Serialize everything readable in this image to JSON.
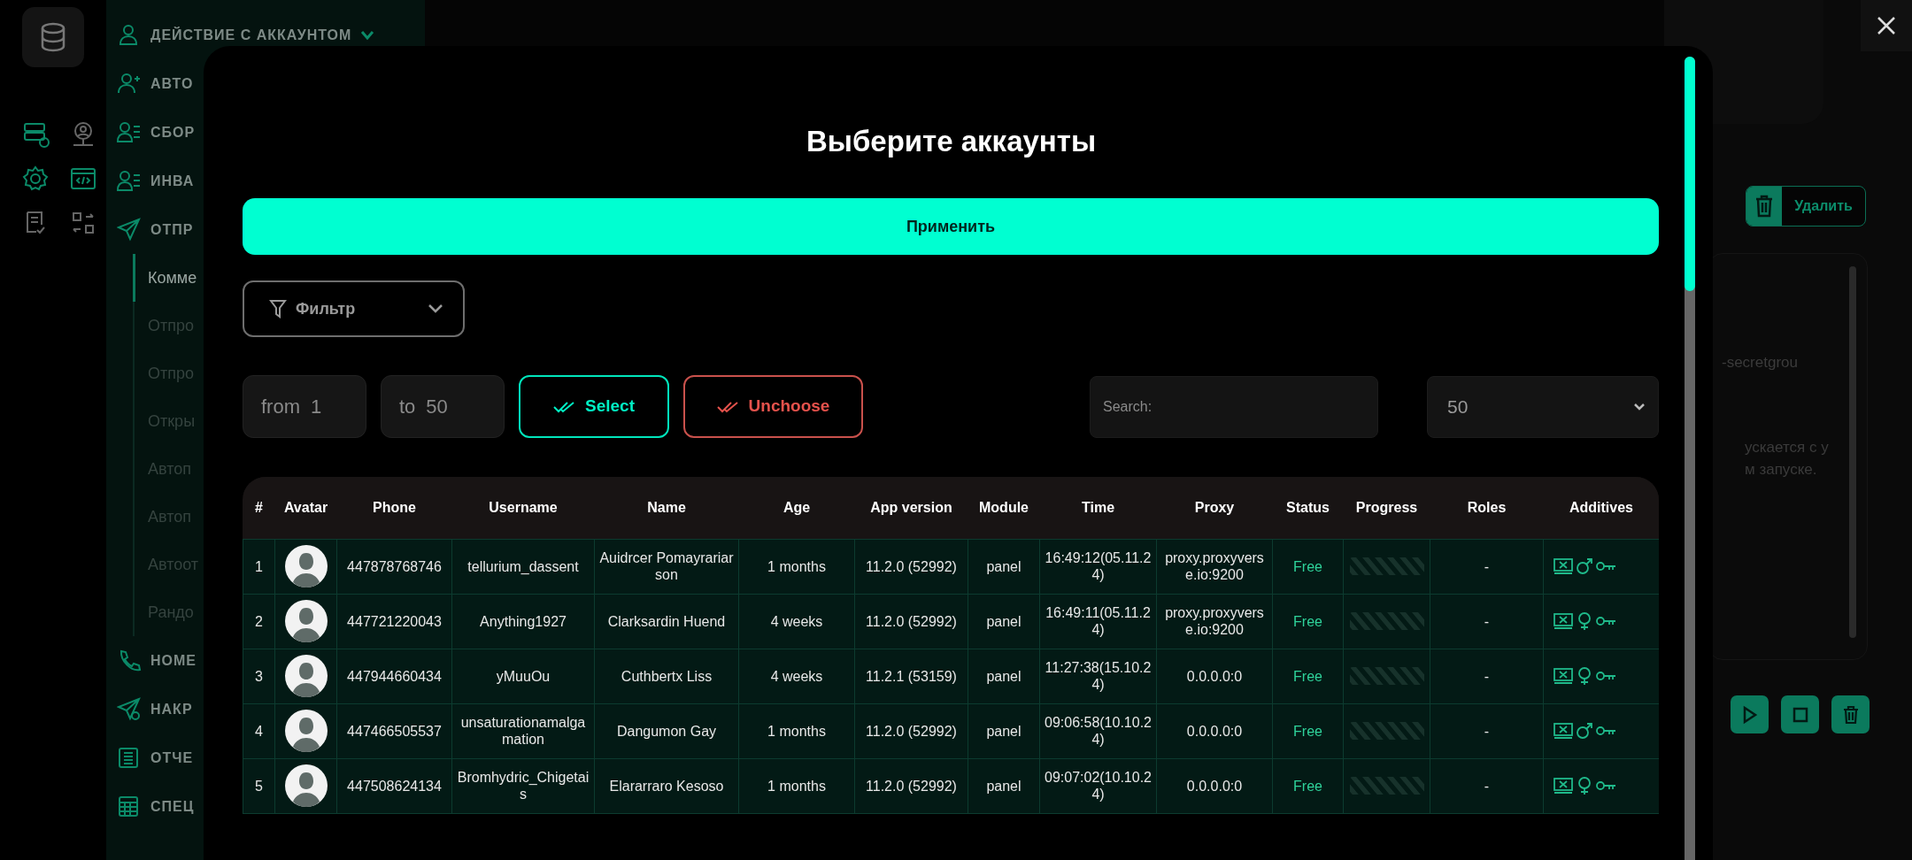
{
  "sidebar": {
    "items": [
      {
        "label": "ДЕЙСТВИЕ С АККАУНТОМ",
        "kind": "section",
        "expanded": true
      },
      {
        "label": "АВТО",
        "kind": "section",
        "expanded": false
      },
      {
        "label": "СБОР",
        "kind": "section",
        "expanded": false
      },
      {
        "label": "ИНВА",
        "kind": "section",
        "expanded": false
      },
      {
        "label": "ОТПР",
        "kind": "section",
        "expanded": false
      },
      {
        "label": "Комме",
        "kind": "sub",
        "selected": true
      },
      {
        "label": "Отпро",
        "kind": "sub",
        "selected": false
      },
      {
        "label": "Отпро",
        "kind": "sub",
        "selected": false
      },
      {
        "label": "Откры",
        "kind": "sub",
        "selected": false
      },
      {
        "label": "Автоп",
        "kind": "sub",
        "selected": false
      },
      {
        "label": "Автоп",
        "kind": "sub",
        "selected": false
      },
      {
        "label": "Автоот",
        "kind": "sub",
        "selected": false
      },
      {
        "label": "Рандо",
        "kind": "sub",
        "selected": false
      },
      {
        "label": "НОМЕ",
        "kind": "section",
        "expanded": false
      },
      {
        "label": "НАКР",
        "kind": "section",
        "expanded": false
      },
      {
        "label": "ОТЧЕ",
        "kind": "section",
        "expanded": false
      },
      {
        "label": "СПЕЦ",
        "kind": "section",
        "expanded": false
      }
    ]
  },
  "right_panel": {
    "delete_button": "Удалить",
    "log_lines": [
      "-secretgrou",
      "ускается с у",
      "м запуске."
    ]
  },
  "modal": {
    "title": "Выберите аккаунты",
    "apply_button": "Применить",
    "filter": {
      "label": "Фильтр"
    },
    "range": {
      "from_label": "from",
      "from_value": "1",
      "to_label": "to",
      "to_value": "50"
    },
    "select_button": "Select",
    "unchoose_button": "Unchoose",
    "search": {
      "placeholder": "Search:"
    },
    "page_size": "50",
    "table": {
      "columns": [
        "#",
        "Avatar",
        "Phone",
        "Username",
        "Name",
        "Age",
        "App version",
        "Module",
        "Time",
        "Proxy",
        "Status",
        "Progress",
        "Roles",
        "Additives"
      ],
      "rows": [
        {
          "index": "1",
          "phone": "447878768746",
          "username": "tellurium_dassent",
          "name": "Auidrcer Pomayrariarson",
          "age": "1 months",
          "app_version": "11.2.0 (52992)",
          "module": "panel",
          "time": "16:49:12(05.11.24)",
          "proxy": "proxy.proxyverse.io:9200",
          "status": "Free",
          "roles": "-",
          "male": true
        },
        {
          "index": "2",
          "phone": "447721220043",
          "username": "Anything1927",
          "name": "Clarksardin Huend",
          "age": "4 weeks",
          "app_version": "11.2.0 (52992)",
          "module": "panel",
          "time": "16:49:11(05.11.24)",
          "proxy": "proxy.proxyverse.io:9200",
          "status": "Free",
          "roles": "-",
          "male": false
        },
        {
          "index": "3",
          "phone": "447944660434",
          "username": "yMuuOu",
          "name": "Cuthbertx Liss",
          "age": "4 weeks",
          "app_version": "11.2.1 (53159)",
          "module": "panel",
          "time": "11:27:38(15.10.24)",
          "proxy": "0.0.0.0:0",
          "status": "Free",
          "roles": "-",
          "male": false
        },
        {
          "index": "4",
          "phone": "447466505537",
          "username": "unsaturationamalgamation",
          "name": "Dangumon Gay",
          "age": "1 months",
          "app_version": "11.2.0 (52992)",
          "module": "panel",
          "time": "09:06:58(10.10.24)",
          "proxy": "0.0.0.0:0",
          "status": "Free",
          "roles": "-",
          "male": true
        },
        {
          "index": "5",
          "phone": "447508624134",
          "username": "Bromhydric_Chigetais",
          "name": "Elararraro Kesoso",
          "age": "1 months",
          "app_version": "11.2.0 (52992)",
          "module": "panel",
          "time": "09:07:02(10.10.24)",
          "proxy": "0.0.0.0:0",
          "status": "Free",
          "roles": "-",
          "male": false
        }
      ]
    }
  }
}
